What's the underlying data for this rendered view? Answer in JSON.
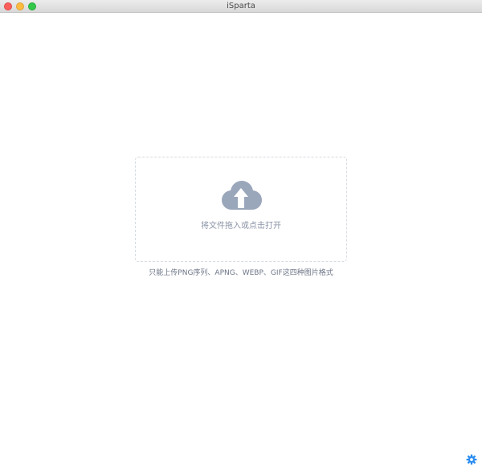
{
  "window": {
    "title": "iSparta"
  },
  "icons": {
    "upload": "cloud-upload-icon",
    "settings": "gear-icon"
  },
  "upload": {
    "drop_text": "将文件拖入或点击打开",
    "hint": "只能上传PNG序列、APNG、WEBP、GIF这四种图片格式"
  },
  "colors": {
    "icon": "#9aa6ba",
    "settings": "#2a8cf0"
  }
}
